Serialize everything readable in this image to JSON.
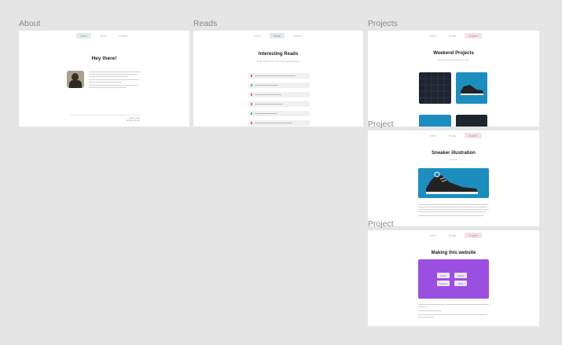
{
  "frames": {
    "about": {
      "label": "About",
      "nav": [
        "Home",
        "About",
        "Projects"
      ],
      "title": "Hey there!",
      "footer": [
        "Legal © 2021",
        "Designed & built"
      ]
    },
    "reads": {
      "label": "Reads",
      "nav": [
        "Home",
        "Reads",
        "Projects"
      ],
      "title": "Interesting Reads",
      "subtitle": "Books, articles, and videos I found interesting lately",
      "items_colors": [
        "#e0607e",
        "#5aa3e8",
        "#e0607e",
        "#e0607e",
        "#3fbf7f",
        "#e0607e"
      ]
    },
    "projects": {
      "label": "Projects",
      "nav": [
        "Home",
        "Reads",
        "Projects"
      ],
      "title": "Weekend Projects",
      "subtitle": "Side projects that I worked on in 2021"
    },
    "project_sneaker": {
      "label": "Project",
      "nav": [
        "Home",
        "Reads",
        "Projects"
      ],
      "title": "Sneaker illustration",
      "subtitle": "July 2021"
    },
    "project_website": {
      "label": "Project",
      "nav": [
        "Home",
        "Reads",
        "Projects"
      ],
      "title": "Making this website",
      "buttons": [
        "About",
        "Reads",
        "Projects",
        "Blog"
      ]
    }
  },
  "colors": {
    "canvas": "#e5e5e5",
    "accent_green": "#7aa79e",
    "accent_blue": "#7c8fb0",
    "accent_pink": "#c77f93",
    "sneaker_bg": "#1b8dbf",
    "website_purple": "#9b4fe0"
  }
}
